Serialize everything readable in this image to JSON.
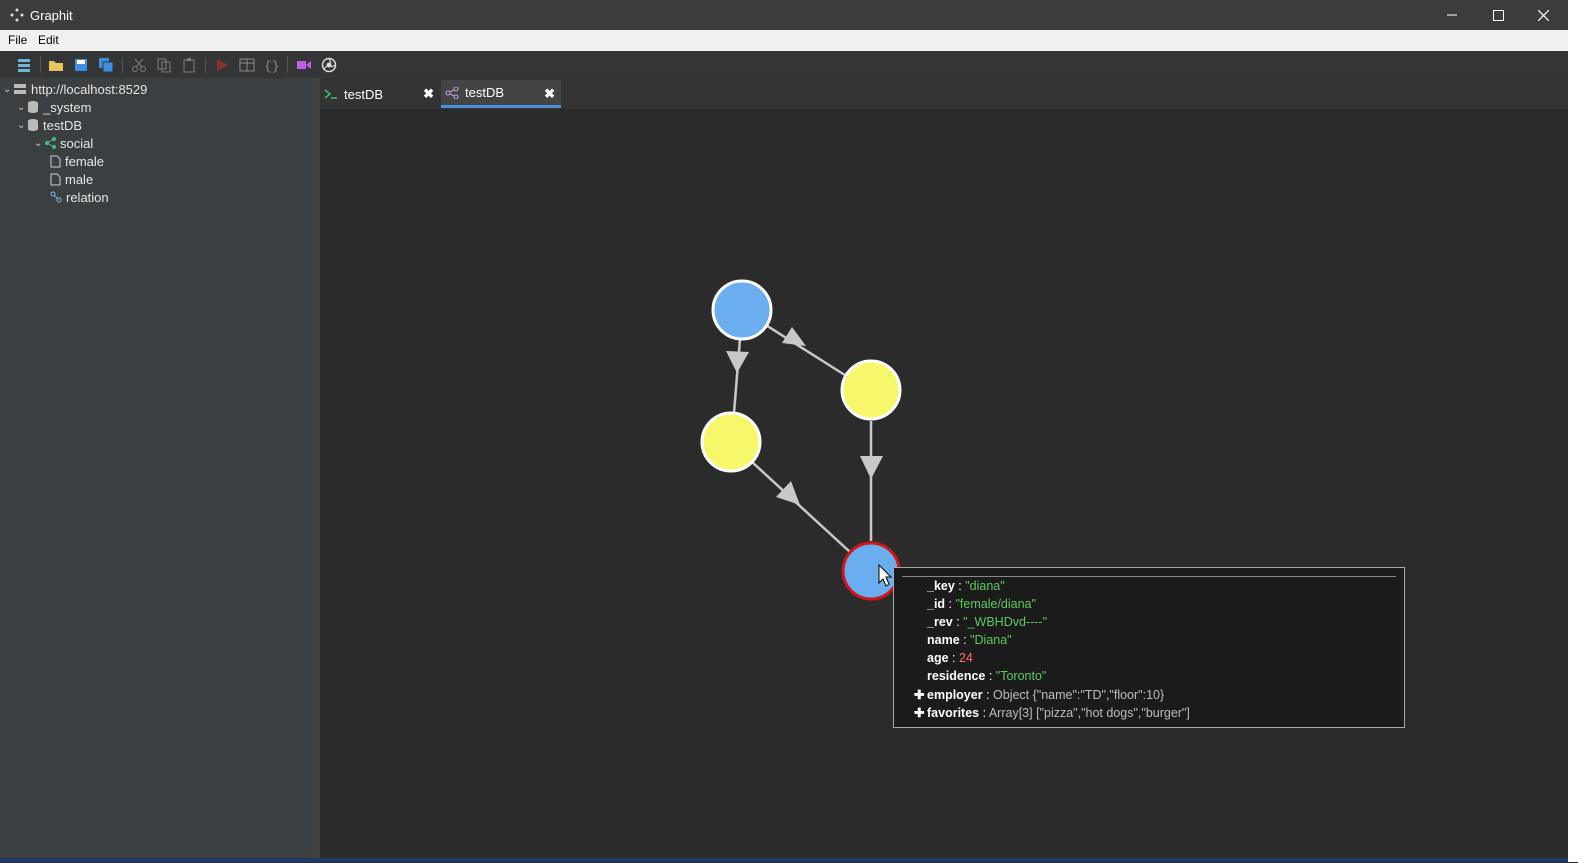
{
  "window": {
    "title": "Graphit",
    "min_icon": "minimize-icon",
    "max_icon": "maximize-icon",
    "close_icon": "close-icon"
  },
  "menu": {
    "file": "File",
    "edit": "Edit"
  },
  "toolbar": {
    "icons": [
      "server-list-icon",
      "open-folder-icon",
      "save-icon",
      "save-all-icon",
      "cut-icon",
      "copy-icon",
      "paste-icon",
      "run-icon",
      "table-view-icon",
      "json-view-icon",
      "record-icon",
      "aperture-icon"
    ]
  },
  "tree": {
    "server": "http://localhost:8529",
    "db_system": "_system",
    "db_test": "testDB",
    "graph": "social",
    "coll_female": "female",
    "coll_male": "male",
    "coll_relation": "relation"
  },
  "tabs": [
    {
      "label": "testDB",
      "icon": "console-icon"
    },
    {
      "label": "testDB",
      "icon": "graph-icon"
    }
  ],
  "graph": {
    "node_colors": {
      "female": "#6aaef0",
      "male": "#f7f76b",
      "selected_border": "#d0161c"
    },
    "edge_color": "#c8c8c8"
  },
  "tooltip": {
    "key_k": "_key",
    "key_v": "\"diana\"",
    "id_k": "_id",
    "id_v": "\"female/diana\"",
    "rev_k": "_rev",
    "rev_v": "\"_WBHDvd----\"",
    "name_k": "name",
    "name_v": "\"Diana\"",
    "age_k": "age",
    "age_v": "24",
    "res_k": "residence",
    "res_v": "\"Toronto\"",
    "emp_k": "employer",
    "emp_v": "Object {\"name\":\"TD\",\"floor\":10}",
    "fav_k": "favorites",
    "fav_v": "Array[3] [\"pizza\",\"hot dogs\",\"burger\"]",
    "sep": " : "
  }
}
